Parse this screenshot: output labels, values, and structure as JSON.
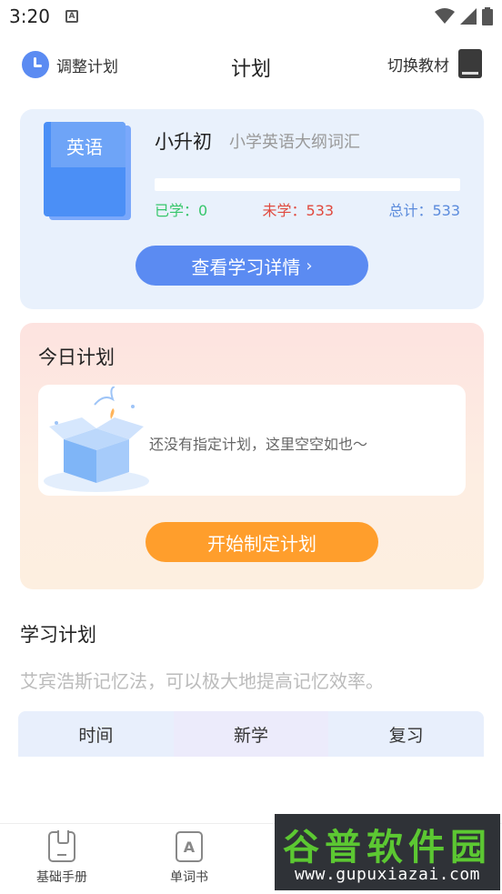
{
  "status_bar": {
    "time": "3:20",
    "notification_letter": "A"
  },
  "header": {
    "adjust_label": "调整计划",
    "title": "计划",
    "switch_label": "切换教材"
  },
  "book": {
    "cover_label": "英语",
    "grade": "小升初",
    "vocab_name": "小学英语大纲词汇",
    "progress_fraction": 0,
    "learned": "已学：0",
    "unlearned": "未学：533",
    "total": "总计：533",
    "detail_button": "查看学习详情"
  },
  "today": {
    "title": "今日计划",
    "empty_text": "还没有指定计划，这里空空如也～",
    "start_button": "开始制定计划"
  },
  "study_plan": {
    "title": "学习计划",
    "description": "艾宾浩斯记忆法，可以极大地提高记忆效率。",
    "columns": [
      "时间",
      "新学",
      "复习"
    ]
  },
  "tabbar": {
    "items": [
      {
        "label": "基础手册",
        "icon": "handbook-icon"
      },
      {
        "label": "单词书",
        "icon": "wordbook-icon"
      }
    ]
  },
  "watermark": {
    "title": "谷普软件园",
    "url": "www.gupuxiazai.com"
  },
  "colors": {
    "accent_blue": "#5b8bf2",
    "accent_orange": "#ff9e2c",
    "learned_green": "#36c66b",
    "unlearned_red": "#e04a3f"
  }
}
